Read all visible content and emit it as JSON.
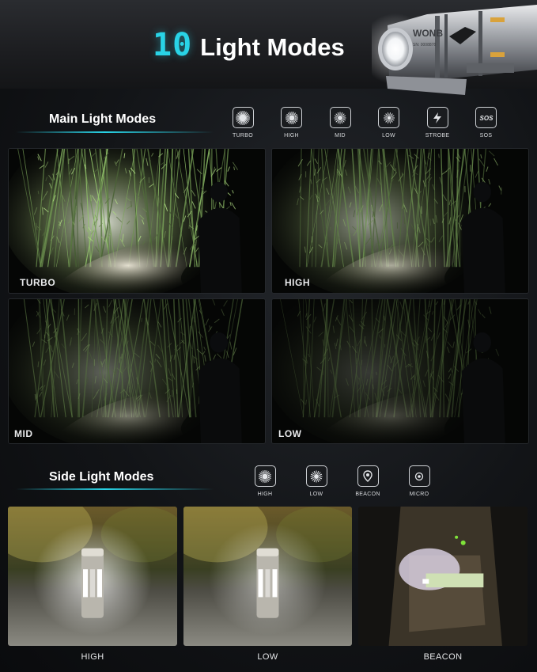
{
  "header": {
    "title_number": "10",
    "title_text": "Light Modes",
    "flashlight_engraving": "WONB",
    "flashlight_serial": "SN: 0008878"
  },
  "main_section": {
    "title": "Main Light Modes",
    "icons": [
      {
        "label": "TURBO",
        "icon": "sun-large-icon"
      },
      {
        "label": "HIGH",
        "icon": "sun-medium-icon"
      },
      {
        "label": "MID",
        "icon": "sun-small-icon"
      },
      {
        "label": "LOW",
        "icon": "sun-tiny-icon"
      },
      {
        "label": "STROBE",
        "icon": "lightning-icon"
      },
      {
        "label": "SOS",
        "icon": "sos-icon"
      }
    ],
    "panels": [
      {
        "label": "TURBO",
        "brightness": 1.0
      },
      {
        "label": "HIGH",
        "brightness": 0.7
      },
      {
        "label": "MID",
        "brightness": 0.45
      },
      {
        "label": "LOW",
        "brightness": 0.25
      }
    ]
  },
  "side_section": {
    "title": "Side Light Modes",
    "icons": [
      {
        "label": "HIGH",
        "icon": "sun-medium-icon"
      },
      {
        "label": "LOW",
        "icon": "sun-small-icon"
      },
      {
        "label": "BEACON",
        "icon": "beacon-icon"
      },
      {
        "label": "MICRO",
        "icon": "micro-icon"
      }
    ],
    "panels": [
      {
        "label": "HIGH",
        "brightness": 1.0
      },
      {
        "label": "LOW",
        "brightness": 0.7
      },
      {
        "label": "BEACON",
        "brightness": 0.4
      }
    ]
  },
  "colors": {
    "accent": "#29d3e6",
    "background": "#121417",
    "text": "#ffffff"
  }
}
